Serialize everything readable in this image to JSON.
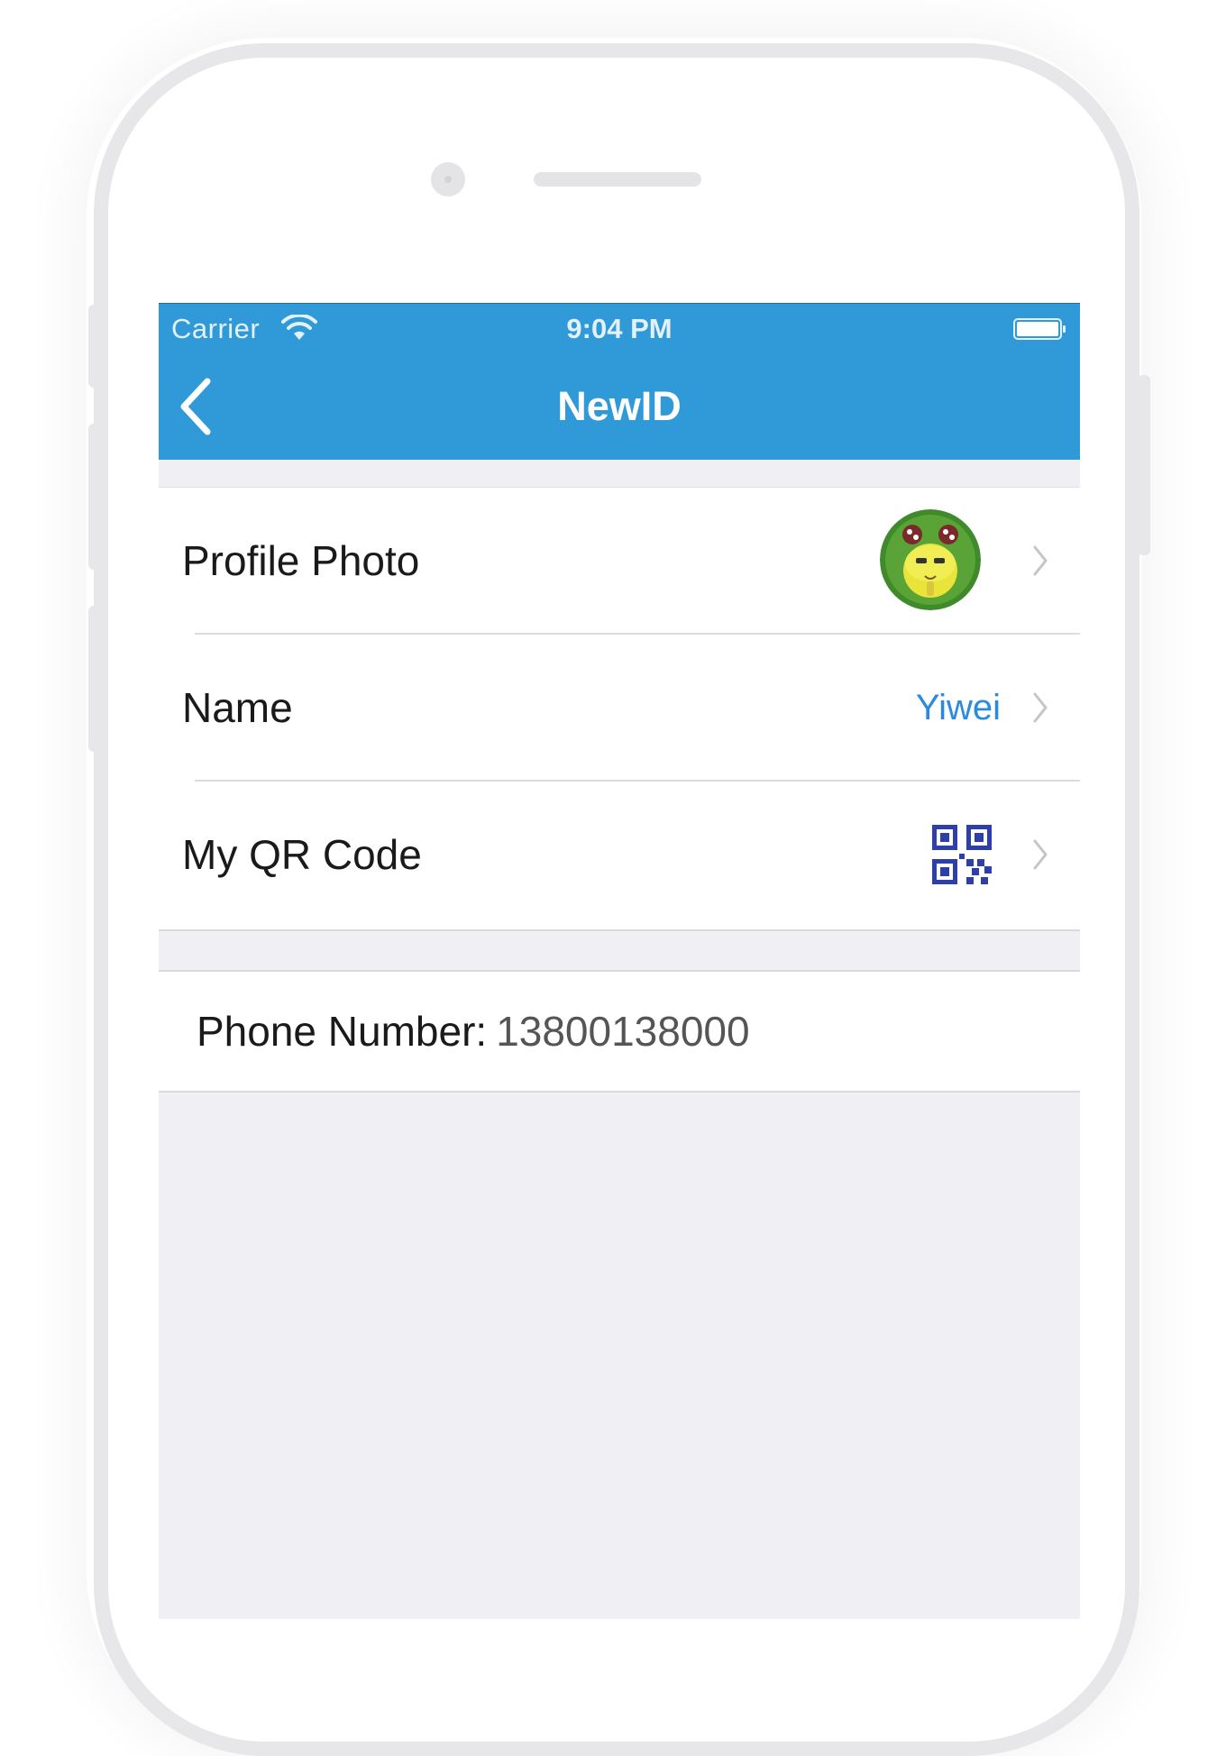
{
  "status_bar": {
    "carrier": "Carrier",
    "time": "9:04 PM"
  },
  "nav_bar": {
    "title": "NewID",
    "back_icon": "chevron-left-icon",
    "background_color": "#3099d8"
  },
  "profile": {
    "rows": [
      {
        "label": "Profile Photo",
        "accessory": "avatar-image"
      },
      {
        "label": "Name",
        "value": "Yiwei",
        "value_color": "#2b8ae0"
      },
      {
        "label": "My QR Code",
        "accessory": "qr-code-icon",
        "accessory_color": "#2e3fa8"
      }
    ]
  },
  "phone": {
    "label": "Phone Number:",
    "value": "13800138000"
  }
}
